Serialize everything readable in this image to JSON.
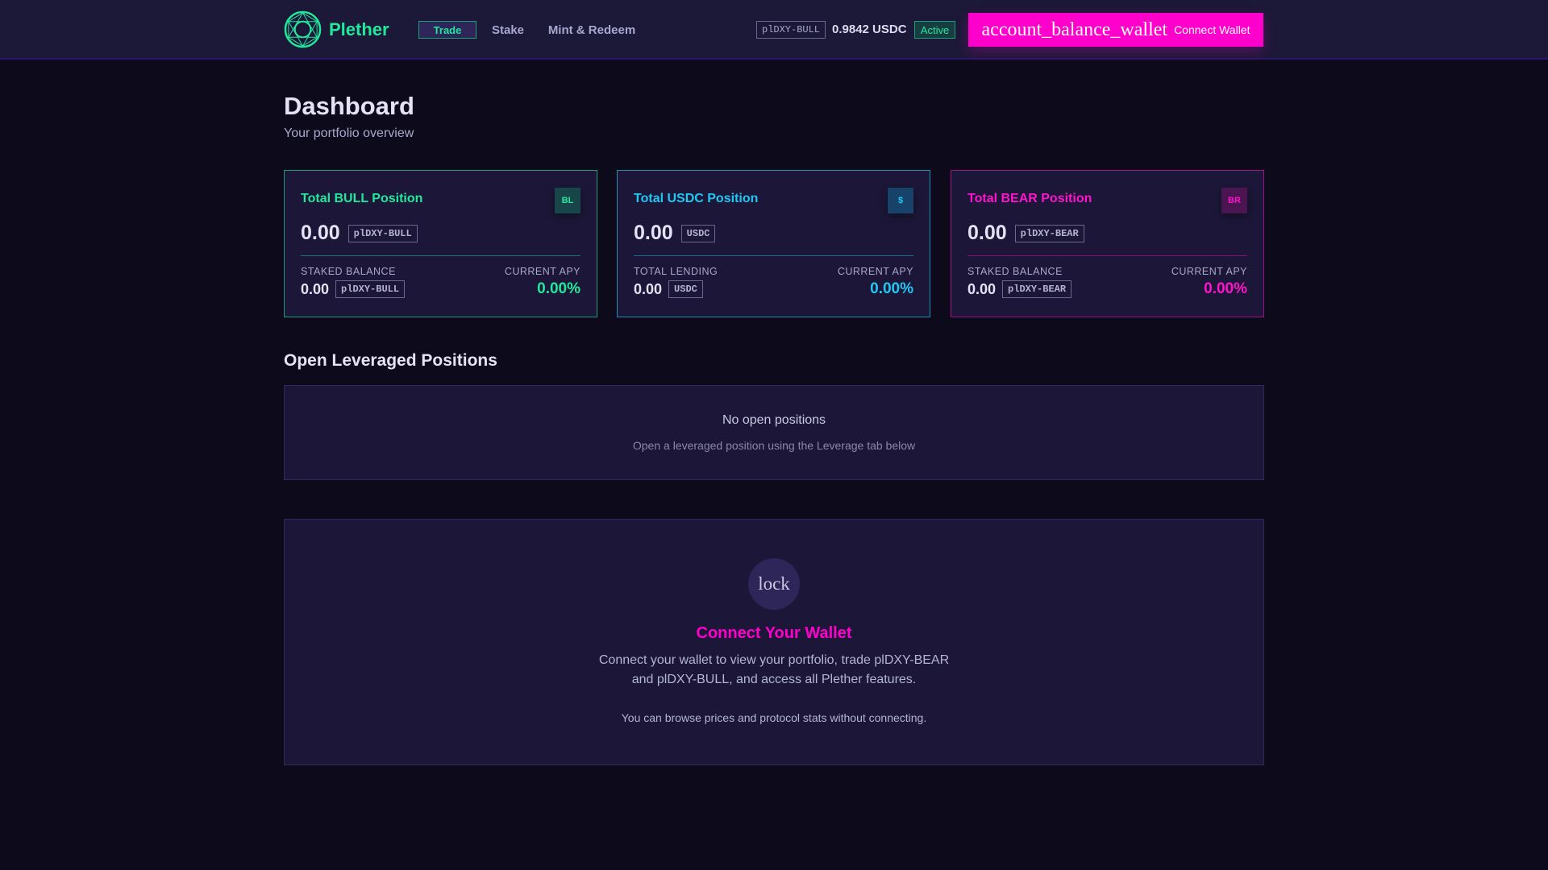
{
  "header": {
    "brand": "Plether",
    "nav": [
      {
        "label": "Trade",
        "active": true
      },
      {
        "label": "Stake"
      },
      {
        "label": "Mint & Redeem"
      }
    ],
    "token": "plDXY-BULL",
    "price": "0.9842 USDC",
    "status": "Active",
    "connect_icon": "account_balance_wallet",
    "connect_label": "Connect Wallet"
  },
  "page": {
    "title": "Dashboard",
    "subtitle": "Your portfolio overview"
  },
  "cards": [
    {
      "title": "Total BULL Position",
      "icon": "BL",
      "value": "0.00",
      "token": "plDXY-BULL",
      "sub_label": "STAKED BALANCE",
      "sub_value": "0.00",
      "sub_token": "plDXY-BULL",
      "apy_label": "CURRENT APY",
      "apy": "0.00%",
      "color": "#22e89c"
    },
    {
      "title": "Total USDC Position",
      "icon": "$",
      "value": "0.00",
      "token": "USDC",
      "sub_label": "TOTAL LENDING",
      "sub_value": "0.00",
      "sub_token": "USDC",
      "apy_label": "CURRENT APY",
      "apy": "0.00%",
      "color": "#22c8f2"
    },
    {
      "title": "Total BEAR Position",
      "icon": "BR",
      "value": "0.00",
      "token": "plDXY-BEAR",
      "sub_label": "STAKED BALANCE",
      "sub_value": "0.00",
      "sub_token": "plDXY-BEAR",
      "apy_label": "CURRENT APY",
      "apy": "0.00%",
      "color": "#ff14cc"
    }
  ],
  "positions": {
    "title": "Open Leveraged Positions",
    "empty_title": "No open positions",
    "empty_hint": "Open a leveraged position using the Leverage tab below"
  },
  "wallet_prompt": {
    "icon": "lock",
    "title": "Connect Your Wallet",
    "line1": "Connect your wallet to view your portfolio, trade plDXY-BEAR",
    "line2": "and plDXY-BULL, and access all Plether features.",
    "note": "You can browse prices and protocol stats without connecting."
  }
}
